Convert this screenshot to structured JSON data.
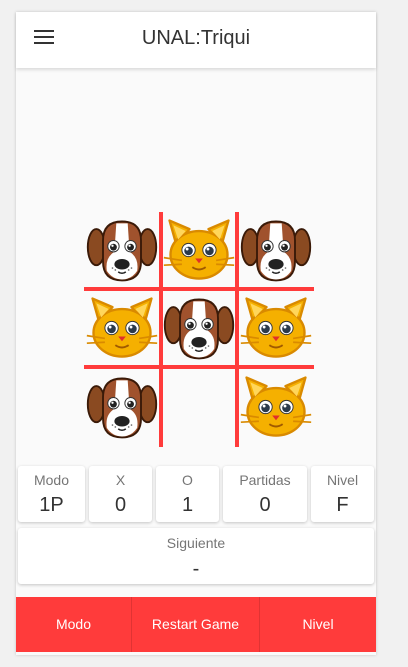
{
  "app": {
    "title": "UNAL:Triqui"
  },
  "board": {
    "cells": [
      "dog",
      "cat",
      "dog",
      "cat",
      "dog",
      "cat",
      "dog",
      "",
      "cat"
    ]
  },
  "stats": {
    "modo": {
      "label": "Modo",
      "value": "1P"
    },
    "x": {
      "label": "X",
      "value": "0"
    },
    "o": {
      "label": "O",
      "value": "1"
    },
    "partidas": {
      "label": "Partidas",
      "value": "0"
    },
    "nivel": {
      "label": "Nivel",
      "value": "F"
    }
  },
  "next": {
    "label": "Siguiente",
    "value": "-"
  },
  "buttons": {
    "modo": "Modo",
    "restart": "Restart Game",
    "nivel": "Nivel"
  },
  "colors": {
    "accent": "#ff3b3b",
    "cat": "#f5b000",
    "dog": "#a0522d"
  }
}
